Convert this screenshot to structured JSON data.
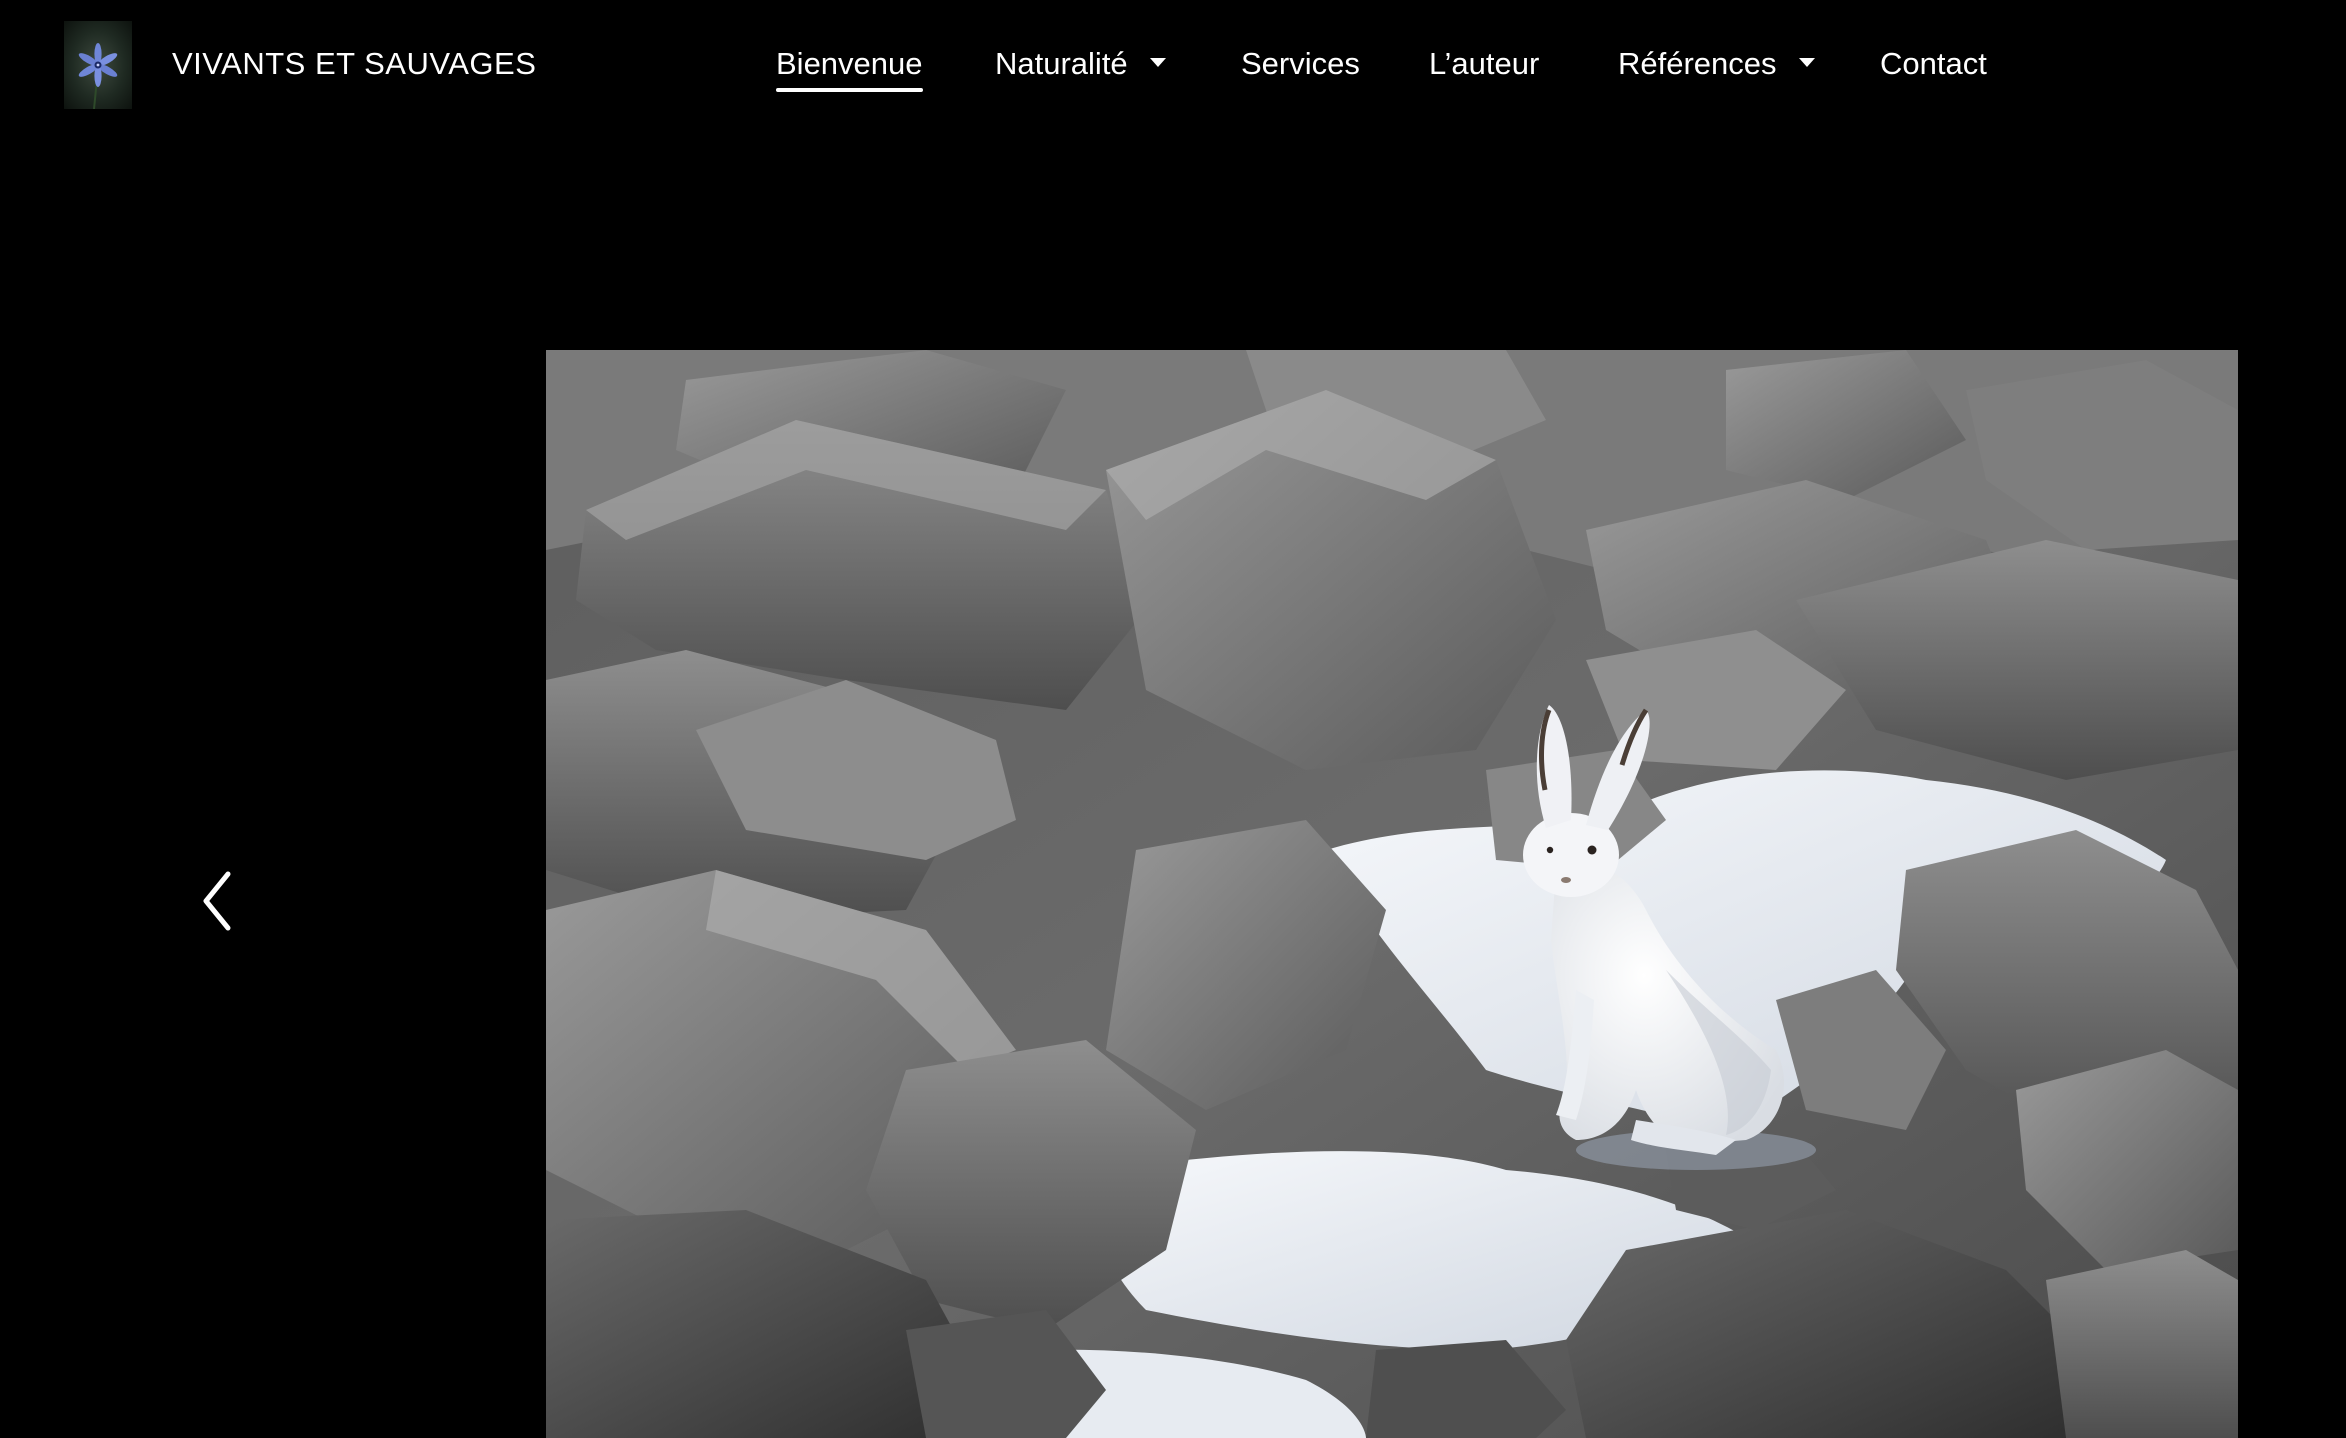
{
  "site": {
    "title": "VIVANTS ET SAUVAGES",
    "logo_icon": "blue-flower-icon"
  },
  "nav": {
    "items": [
      {
        "label": "Bienvenue",
        "active": true,
        "has_dropdown": false
      },
      {
        "label": "Naturalité",
        "active": false,
        "has_dropdown": true
      },
      {
        "label": "Services",
        "active": false,
        "has_dropdown": false
      },
      {
        "label": "L’auteur",
        "active": false,
        "has_dropdown": false
      },
      {
        "label": "Références",
        "active": false,
        "has_dropdown": true
      },
      {
        "label": "Contact",
        "active": false,
        "has_dropdown": false
      }
    ]
  },
  "slider": {
    "prev_icon": "chevron-left-icon",
    "photo_subject": "white-hare-on-snowy-rocks-photo"
  },
  "colors": {
    "background": "#000000",
    "text": "#ffffff",
    "logo_flower": "#6f86d8"
  }
}
